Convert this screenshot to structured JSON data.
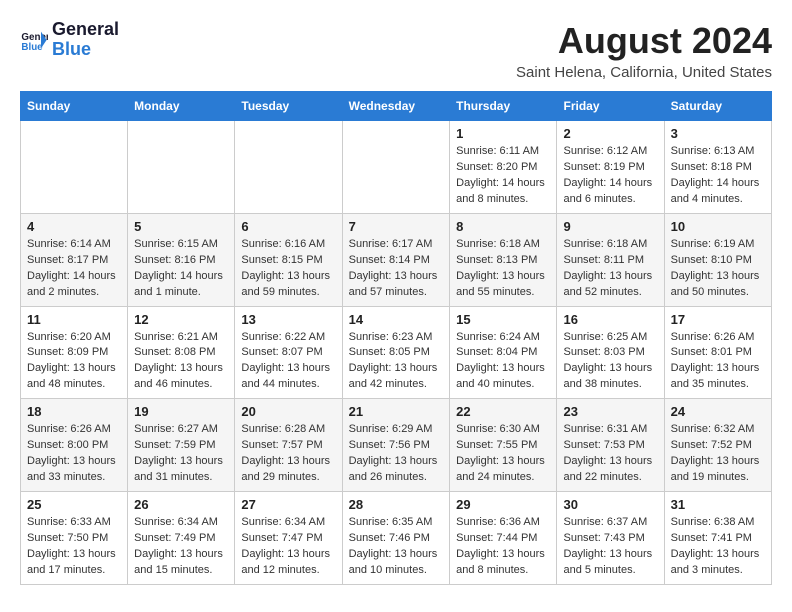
{
  "header": {
    "logo_line1": "General",
    "logo_line2": "Blue",
    "month_year": "August 2024",
    "location": "Saint Helena, California, United States"
  },
  "days_of_week": [
    "Sunday",
    "Monday",
    "Tuesday",
    "Wednesday",
    "Thursday",
    "Friday",
    "Saturday"
  ],
  "weeks": [
    [
      {
        "day": "",
        "info": ""
      },
      {
        "day": "",
        "info": ""
      },
      {
        "day": "",
        "info": ""
      },
      {
        "day": "",
        "info": ""
      },
      {
        "day": "1",
        "info": "Sunrise: 6:11 AM\nSunset: 8:20 PM\nDaylight: 14 hours\nand 8 minutes."
      },
      {
        "day": "2",
        "info": "Sunrise: 6:12 AM\nSunset: 8:19 PM\nDaylight: 14 hours\nand 6 minutes."
      },
      {
        "day": "3",
        "info": "Sunrise: 6:13 AM\nSunset: 8:18 PM\nDaylight: 14 hours\nand 4 minutes."
      }
    ],
    [
      {
        "day": "4",
        "info": "Sunrise: 6:14 AM\nSunset: 8:17 PM\nDaylight: 14 hours\nand 2 minutes."
      },
      {
        "day": "5",
        "info": "Sunrise: 6:15 AM\nSunset: 8:16 PM\nDaylight: 14 hours\nand 1 minute."
      },
      {
        "day": "6",
        "info": "Sunrise: 6:16 AM\nSunset: 8:15 PM\nDaylight: 13 hours\nand 59 minutes."
      },
      {
        "day": "7",
        "info": "Sunrise: 6:17 AM\nSunset: 8:14 PM\nDaylight: 13 hours\nand 57 minutes."
      },
      {
        "day": "8",
        "info": "Sunrise: 6:18 AM\nSunset: 8:13 PM\nDaylight: 13 hours\nand 55 minutes."
      },
      {
        "day": "9",
        "info": "Sunrise: 6:18 AM\nSunset: 8:11 PM\nDaylight: 13 hours\nand 52 minutes."
      },
      {
        "day": "10",
        "info": "Sunrise: 6:19 AM\nSunset: 8:10 PM\nDaylight: 13 hours\nand 50 minutes."
      }
    ],
    [
      {
        "day": "11",
        "info": "Sunrise: 6:20 AM\nSunset: 8:09 PM\nDaylight: 13 hours\nand 48 minutes."
      },
      {
        "day": "12",
        "info": "Sunrise: 6:21 AM\nSunset: 8:08 PM\nDaylight: 13 hours\nand 46 minutes."
      },
      {
        "day": "13",
        "info": "Sunrise: 6:22 AM\nSunset: 8:07 PM\nDaylight: 13 hours\nand 44 minutes."
      },
      {
        "day": "14",
        "info": "Sunrise: 6:23 AM\nSunset: 8:05 PM\nDaylight: 13 hours\nand 42 minutes."
      },
      {
        "day": "15",
        "info": "Sunrise: 6:24 AM\nSunset: 8:04 PM\nDaylight: 13 hours\nand 40 minutes."
      },
      {
        "day": "16",
        "info": "Sunrise: 6:25 AM\nSunset: 8:03 PM\nDaylight: 13 hours\nand 38 minutes."
      },
      {
        "day": "17",
        "info": "Sunrise: 6:26 AM\nSunset: 8:01 PM\nDaylight: 13 hours\nand 35 minutes."
      }
    ],
    [
      {
        "day": "18",
        "info": "Sunrise: 6:26 AM\nSunset: 8:00 PM\nDaylight: 13 hours\nand 33 minutes."
      },
      {
        "day": "19",
        "info": "Sunrise: 6:27 AM\nSunset: 7:59 PM\nDaylight: 13 hours\nand 31 minutes."
      },
      {
        "day": "20",
        "info": "Sunrise: 6:28 AM\nSunset: 7:57 PM\nDaylight: 13 hours\nand 29 minutes."
      },
      {
        "day": "21",
        "info": "Sunrise: 6:29 AM\nSunset: 7:56 PM\nDaylight: 13 hours\nand 26 minutes."
      },
      {
        "day": "22",
        "info": "Sunrise: 6:30 AM\nSunset: 7:55 PM\nDaylight: 13 hours\nand 24 minutes."
      },
      {
        "day": "23",
        "info": "Sunrise: 6:31 AM\nSunset: 7:53 PM\nDaylight: 13 hours\nand 22 minutes."
      },
      {
        "day": "24",
        "info": "Sunrise: 6:32 AM\nSunset: 7:52 PM\nDaylight: 13 hours\nand 19 minutes."
      }
    ],
    [
      {
        "day": "25",
        "info": "Sunrise: 6:33 AM\nSunset: 7:50 PM\nDaylight: 13 hours\nand 17 minutes."
      },
      {
        "day": "26",
        "info": "Sunrise: 6:34 AM\nSunset: 7:49 PM\nDaylight: 13 hours\nand 15 minutes."
      },
      {
        "day": "27",
        "info": "Sunrise: 6:34 AM\nSunset: 7:47 PM\nDaylight: 13 hours\nand 12 minutes."
      },
      {
        "day": "28",
        "info": "Sunrise: 6:35 AM\nSunset: 7:46 PM\nDaylight: 13 hours\nand 10 minutes."
      },
      {
        "day": "29",
        "info": "Sunrise: 6:36 AM\nSunset: 7:44 PM\nDaylight: 13 hours\nand 8 minutes."
      },
      {
        "day": "30",
        "info": "Sunrise: 6:37 AM\nSunset: 7:43 PM\nDaylight: 13 hours\nand 5 minutes."
      },
      {
        "day": "31",
        "info": "Sunrise: 6:38 AM\nSunset: 7:41 PM\nDaylight: 13 hours\nand 3 minutes."
      }
    ]
  ]
}
